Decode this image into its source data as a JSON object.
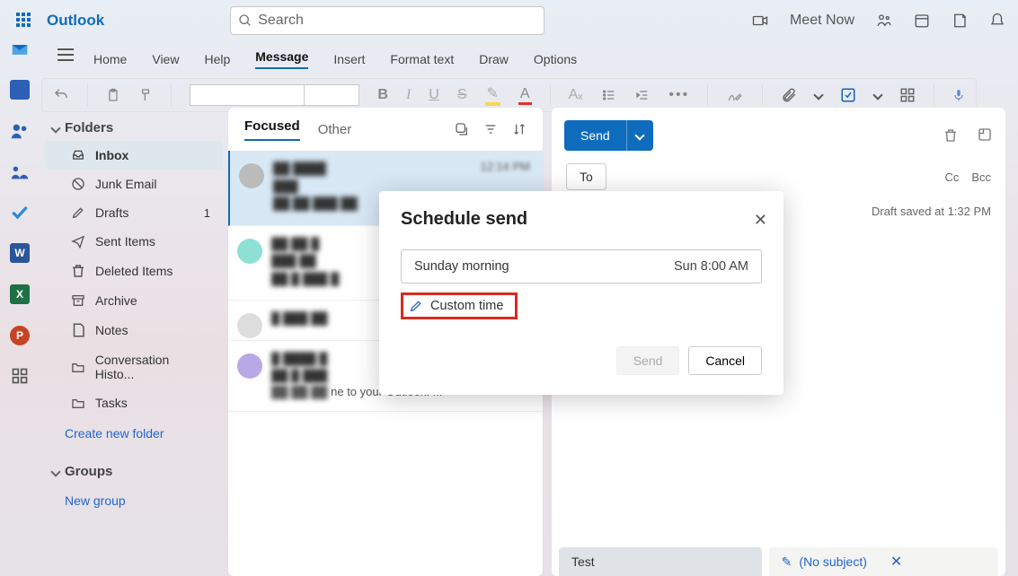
{
  "brand": "Outlook",
  "search_placeholder": "Search",
  "top_right": {
    "meet_now": "Meet Now"
  },
  "ribbon": {
    "home": "Home",
    "view": "View",
    "help": "Help",
    "message": "Message",
    "insert": "Insert",
    "format": "Format text",
    "draw": "Draw",
    "options": "Options"
  },
  "folders_header": "Folders",
  "folders": {
    "inbox": "Inbox",
    "junk": "Junk Email",
    "drafts": "Drafts",
    "drafts_count": "1",
    "sent": "Sent Items",
    "deleted": "Deleted Items",
    "archive": "Archive",
    "notes": "Notes",
    "convo": "Conversation Histo...",
    "tasks": "Tasks",
    "create": "Create new folder"
  },
  "groups_header": "Groups",
  "groups": {
    "new": "New group"
  },
  "msglist": {
    "focused": "Focused",
    "other": "Other",
    "row0_time": "12:14 PM",
    "row3_snippet": "ne to your Outlook! ..."
  },
  "compose": {
    "send": "Send",
    "to": "To",
    "cc": "Cc",
    "bcc": "Bcc",
    "draft_saved": "Draft saved at 1:32 PM"
  },
  "bottom_tabs": {
    "test": "Test",
    "nosubj": "(No subject)"
  },
  "modal": {
    "title": "Schedule send",
    "opt_label": "Sunday morning",
    "opt_time": "Sun 8:00 AM",
    "custom": "Custom time",
    "send": "Send",
    "cancel": "Cancel"
  }
}
